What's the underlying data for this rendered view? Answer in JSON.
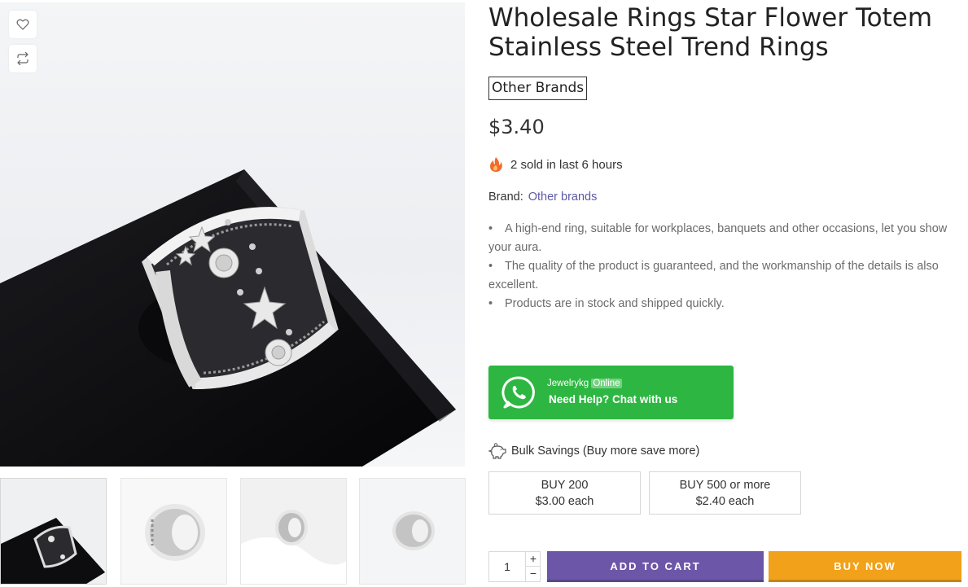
{
  "gallery": {
    "main_image": "silver-star-flower-ring-photo",
    "thumbnails": [
      "ring-on-black-cushion",
      "ring-front-view",
      "ring-on-white-cloth",
      "ring-side-view"
    ]
  },
  "product": {
    "title_line1": "Wholesale Rings Star Flower Totem",
    "title_line2": "Stainless Steel Trend Rings",
    "brand_badge": "Other Brands",
    "price": "$3.40",
    "sold_text": "2 sold in last 6 hours",
    "brand_label": "Brand:",
    "brand_link": "Other brands",
    "bullets": [
      {
        "line1": "A high-end ring, suitable for workplaces, banquets and other occasions, let you show",
        "line2": "your aura."
      },
      {
        "line1": "The quality of the product is guaranteed, and the workmanship of the details is also",
        "line2": "excellent."
      },
      {
        "line1": "Products are in stock and shipped quickly.",
        "line2": ""
      }
    ],
    "bullet_symbol": "•"
  },
  "whatsapp": {
    "name": "Jewelrykg",
    "status": "Online",
    "help": "Need Help? Chat with us",
    "color": "#2db742"
  },
  "bulk": {
    "heading": "Bulk Savings (Buy more save more)",
    "tiers": [
      {
        "qty": "BUY 200",
        "price": "$3.00 each"
      },
      {
        "qty": "BUY 500 or more",
        "price": "$2.40 each"
      }
    ]
  },
  "cart": {
    "quantity": "1",
    "plus": "+",
    "minus": "−",
    "add_to_cart": "ADD TO CART",
    "buy_now": "BUY NOW",
    "add_color": "#6c56a8",
    "buy_color": "#f2a11a"
  }
}
